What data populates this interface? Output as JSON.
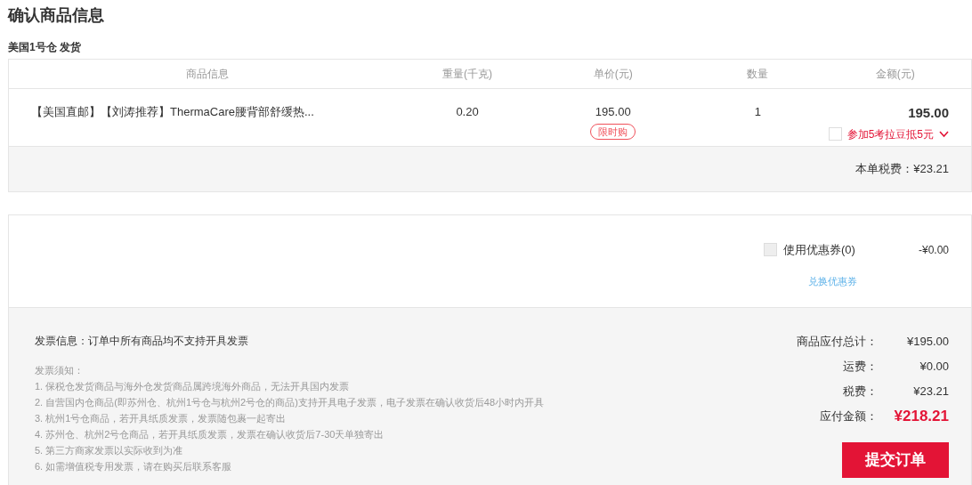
{
  "title": "确认商品信息",
  "warehouse": "美国1号仓 发货",
  "table": {
    "columns": [
      "商品信息",
      "重量(千克)",
      "单价(元)",
      "数量",
      "金额(元)"
    ],
    "rows": [
      {
        "name": "【美国直邮】【刘涛推荐】ThermaCare腰背部舒缓热...",
        "weight": "0.20",
        "unit_price": "195.00",
        "promo_tag": "限时购",
        "quantity": "1",
        "amount": "195.00",
        "bean_offer": {
          "label": "参加5考拉豆抵5元",
          "checked": false
        }
      }
    ]
  },
  "tax_line": "本单税费：¥23.21",
  "coupon": {
    "label": "使用优惠券(0)",
    "checked": false,
    "amount": "-¥0.00",
    "redeem_link": "兑换优惠券"
  },
  "invoice": {
    "info": "发票信息：订单中所有商品均不支持开具发票",
    "notice_title": "发票须知：",
    "notices": [
      "1. 保税仓发货商品与海外仓发货商品属跨境海外商品，无法开具国内发票",
      "2. 自营国内仓商品(即苏州仓、杭州1号仓与杭州2号仓的商品)支持开具电子发票，电子发票在确认收货后48小时内开具",
      "3. 杭州1号仓商品，若开具纸质发票，发票随包裹一起寄出",
      "4. 苏州仓、杭州2号仓商品，若开具纸质发票，发票在确认收货后7-30天单独寄出",
      "5. 第三方商家发票以实际收到为准",
      "6. 如需增值税专用发票，请在购买后联系客服"
    ]
  },
  "summary": [
    {
      "label": "商品应付总计：",
      "value": "¥195.00"
    },
    {
      "label": "运费：",
      "value": "¥0.00"
    },
    {
      "label": "税费：",
      "value": "¥23.21"
    }
  ],
  "total": {
    "label": "应付金额：",
    "value": "¥218.21"
  },
  "submit": "提交订单"
}
